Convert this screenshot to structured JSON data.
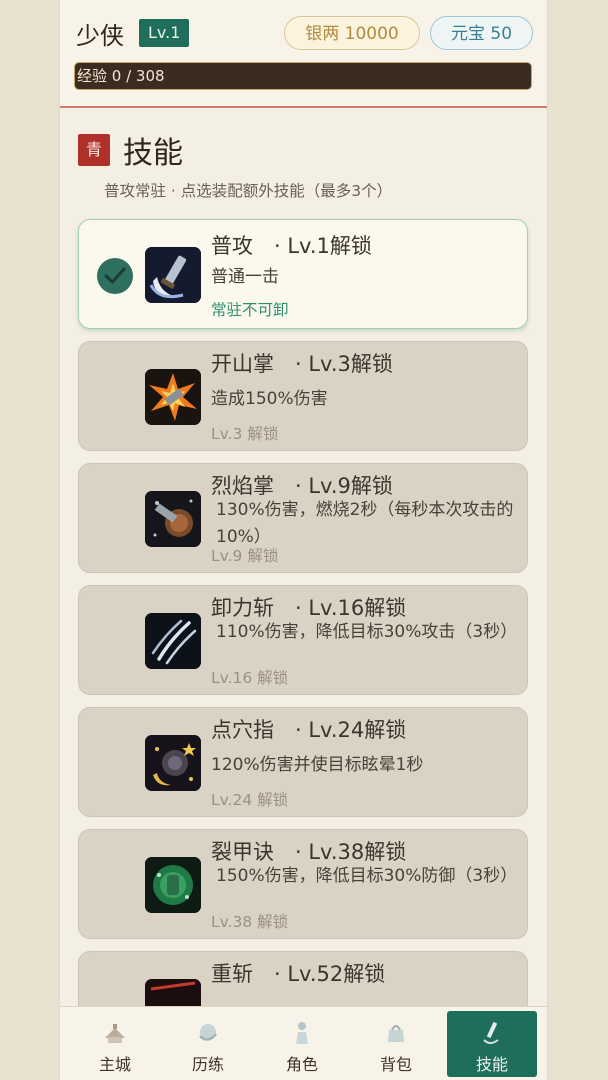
{
  "header": {
    "player_name": "少侠",
    "level": "Lv.1",
    "silver": "银两 10000",
    "ingot": "元宝 50",
    "exp_text": "经验 0 / 308",
    "exp_progress": 0
  },
  "section": {
    "badge": "青",
    "title": "技能",
    "subtitle": "普攻常驻 · 点选装配额外技能（最多3个）"
  },
  "skills": [
    {
      "name": "普攻　· Lv.1解锁",
      "desc": "普通一击",
      "state": "常驻不可卸",
      "icon": "sword-moon-icon",
      "active": true
    },
    {
      "name": "开山掌　· Lv.3解锁",
      "desc": "造成150%伤害",
      "state": "Lv.3 解锁",
      "icon": "burst-palm-icon"
    },
    {
      "name": "烈焰掌　· Lv.9解锁",
      "desc": "130%伤害，燃烧2秒（每秒本次攻击的10%）",
      "state": "Lv.9 解锁",
      "icon": "flame-shield-icon"
    },
    {
      "name": "卸力斩　· Lv.16解锁",
      "desc": "110%伤害，降低目标30%攻击（3秒）",
      "state": "Lv.16 解锁",
      "icon": "claw-slash-icon"
    },
    {
      "name": "点穴指　· Lv.24解锁",
      "desc": "120%伤害并使目标眩晕1秒",
      "state": "Lv.24 解锁",
      "icon": "star-stun-icon"
    },
    {
      "name": "裂甲诀　· Lv.38解锁",
      "desc": "150%伤害，降低目标30%防御（3秒）",
      "state": "Lv.38 解锁",
      "icon": "jade-armor-icon"
    },
    {
      "name": "重斩　· Lv.52解锁",
      "desc": "",
      "state": "",
      "icon": "heavy-slash-icon"
    }
  ],
  "nav": [
    {
      "label": "主城",
      "icon": "city-icon"
    },
    {
      "label": "历练",
      "icon": "training-icon"
    },
    {
      "label": "角色",
      "icon": "character-icon"
    },
    {
      "label": "背包",
      "icon": "bag-icon"
    },
    {
      "label": "技能",
      "icon": "skill-icon",
      "active": true
    }
  ],
  "colors": {
    "accent_green": "#1f6e5b",
    "section_red": "#b0312a",
    "silver_gold": "#b38a3c",
    "ingot_blue": "#3b7f93"
  }
}
